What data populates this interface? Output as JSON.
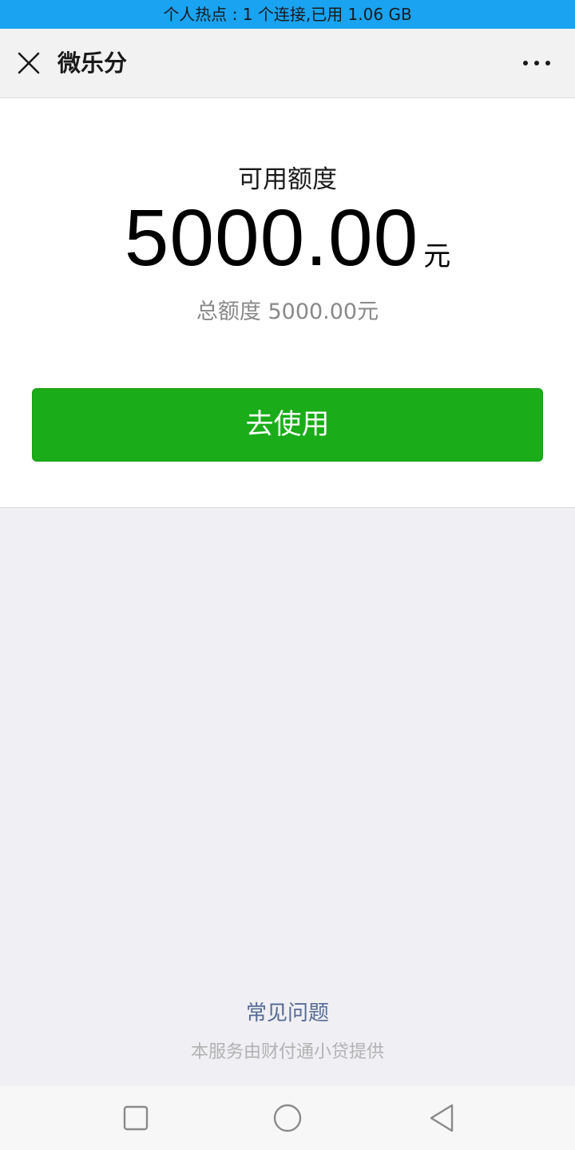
{
  "status_bar": {
    "hotspot_text": "个人热点 : 1 个连接,已用 1.06 GB"
  },
  "title_bar": {
    "close_icon": "close-icon",
    "title": "微乐分",
    "more_icon": "more-dots-icon"
  },
  "credit": {
    "available_label": "可用额度",
    "available_amount": "5000.00",
    "available_unit": "元",
    "total_text": "总额度 5000.00元"
  },
  "actions": {
    "use_button_label": "去使用"
  },
  "footer": {
    "faq_link": "常见问题",
    "provider_note": "本服务由财付通小贷提供"
  },
  "nav_bar": {
    "icons": [
      "recent-apps-icon",
      "home-icon",
      "back-icon"
    ]
  },
  "colors": {
    "primary_green": "#1aad19",
    "link_blue": "#576b95",
    "hotspot_blue": "#1aa3f0",
    "page_background": "#efeff4"
  }
}
